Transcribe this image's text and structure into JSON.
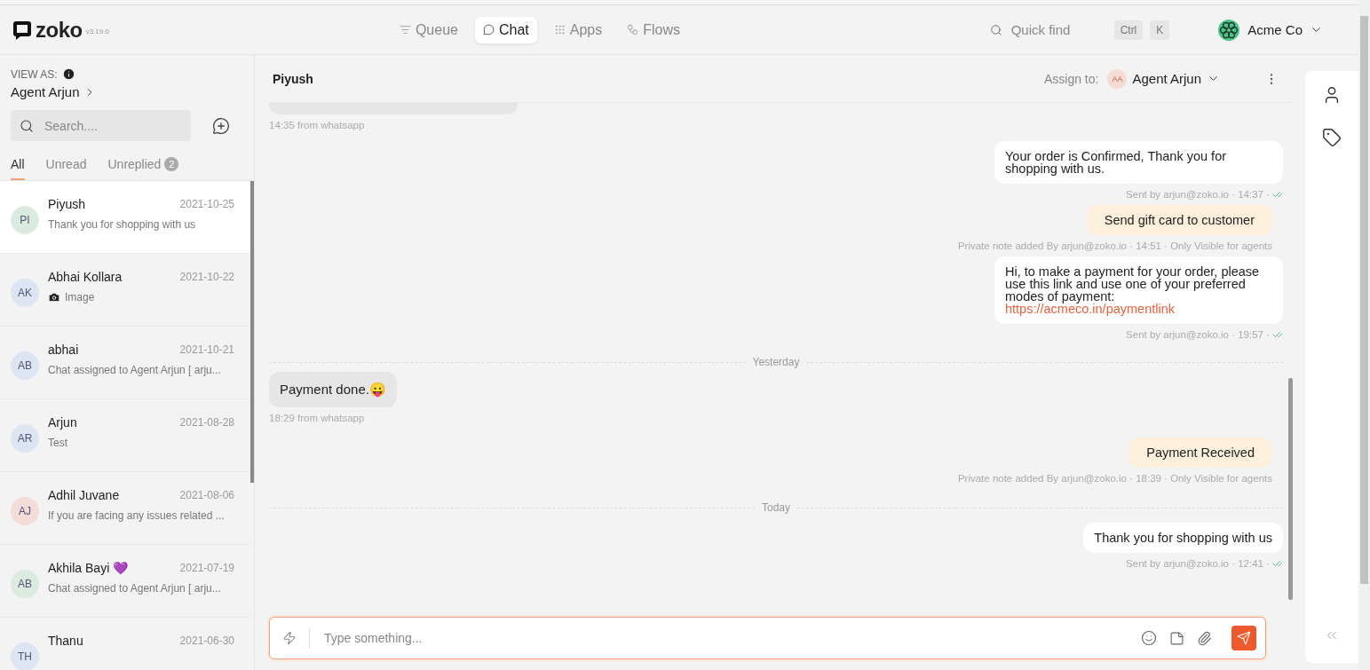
{
  "app": {
    "logo": "zoko",
    "version": "v3.19.0"
  },
  "nav": [
    {
      "label": "Queue",
      "selected": false
    },
    {
      "label": "Chat",
      "selected": true
    },
    {
      "label": "Apps",
      "selected": false
    },
    {
      "label": "Flows",
      "selected": false
    }
  ],
  "quick_find": {
    "placeholder": "Quick find",
    "keys": [
      "Ctrl",
      "K"
    ]
  },
  "account": {
    "name": "Acme Co"
  },
  "sidebar": {
    "view_as_label": "VIEW AS:",
    "agent": "Agent Arjun",
    "search": {
      "placeholder": "Search...."
    },
    "tabs": [
      {
        "label": "All",
        "selected": true
      },
      {
        "label": "Unread",
        "selected": false
      },
      {
        "label": "Unreplied",
        "badge": "2",
        "selected": false
      }
    ],
    "chats": [
      {
        "initials": "PI",
        "color": "#dcebe0",
        "name": "Piyush",
        "date": "2021-10-25",
        "preview": "Thank you for shopping with us",
        "selected": true,
        "attachment": false
      },
      {
        "initials": "AK",
        "color": "#dde5f3",
        "name": "Abhai Kollara",
        "date": "2021-10-22",
        "preview": "Image",
        "selected": false,
        "attachment": true
      },
      {
        "initials": "AB",
        "color": "#dde5f3",
        "name": "abhai",
        "date": "2021-10-21",
        "preview": "Chat assigned to Agent Arjun [ arju...",
        "selected": false,
        "attachment": false
      },
      {
        "initials": "AR",
        "color": "#dde5f3",
        "name": "Arjun",
        "date": "2021-08-28",
        "preview": "Test",
        "selected": false,
        "attachment": false
      },
      {
        "initials": "AJ",
        "color": "#f5dcd8",
        "name": "Adhil Juvane",
        "date": "2021-08-06",
        "preview": "If you are facing any issues related ...",
        "selected": false,
        "attachment": false
      },
      {
        "initials": "AB",
        "color": "#dcebe0",
        "name": "Akhila Bayi 💜",
        "date": "2021-07-19",
        "preview": "Chat assigned to Agent Arjun [ arju...",
        "selected": false,
        "attachment": false
      },
      {
        "initials": "TH",
        "color": "#dde5f3",
        "name": "Thanu",
        "date": "2021-06-30",
        "selected": false,
        "attachment": false
      }
    ]
  },
  "conversation": {
    "contact": "Piyush",
    "assign_label": "Assign to:",
    "assignee_initials": "AA",
    "assignee": "Agent Arjun",
    "messages": [
      {
        "kind": "incoming",
        "meta": "14:35 from whatsapp"
      },
      {
        "kind": "outgoing",
        "text": "Your order is Confirmed, Thank you for shopping with us.",
        "meta": "Sent by arjun@zoko.io · 14:37 ·",
        "delivered": true
      },
      {
        "kind": "note",
        "text": "Send gift card to customer",
        "meta": "Private note added By arjun@zoko.io · 14:51 · Only Visible for agents"
      },
      {
        "kind": "outgoing",
        "text": "Hi, to make a payment for your order, please use this link and use one of your preferred modes of payment:",
        "link": "https://acmeco.in/paymentlink",
        "meta": "Sent by arjun@zoko.io · 19:57 ·",
        "delivered": true
      },
      {
        "kind": "divider",
        "text": "Yesterday"
      },
      {
        "kind": "incoming",
        "text": "Payment done.😛",
        "meta": "18:29 from whatsapp"
      },
      {
        "kind": "note",
        "text": "Payment Received",
        "meta": "Private note added By arjun@zoko.io · 18:39 · Only Visible for agents"
      },
      {
        "kind": "divider",
        "text": "Today"
      },
      {
        "kind": "outgoing",
        "text": "Thank you for shopping with us",
        "meta": "Sent by arjun@zoko.io · 12:41 ·",
        "delivered": true
      }
    ],
    "composer": {
      "placeholder": "Type something..."
    }
  }
}
